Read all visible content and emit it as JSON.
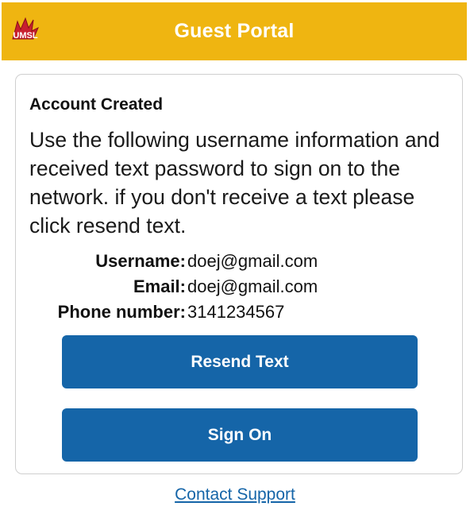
{
  "header": {
    "title": "Guest Portal",
    "logo_icon": "umsl-logo-icon",
    "logo_text": "UMSL",
    "background_color": "#efb511"
  },
  "card": {
    "title": "Account Created",
    "message": "Use the following username information and received text password to sign on to the network. if you don't receive a text please click resend text.",
    "fields": [
      {
        "label": "Username:",
        "value": "doej@gmail.com"
      },
      {
        "label": "Email:",
        "value": "doej@gmail.com"
      },
      {
        "label": "Phone number:",
        "value": "3141234567"
      }
    ]
  },
  "actions": {
    "resend_label": "Resend Text",
    "sign_on_label": "Sign On",
    "button_color": "#1565a8"
  },
  "footer": {
    "support_link": "Contact Support"
  }
}
